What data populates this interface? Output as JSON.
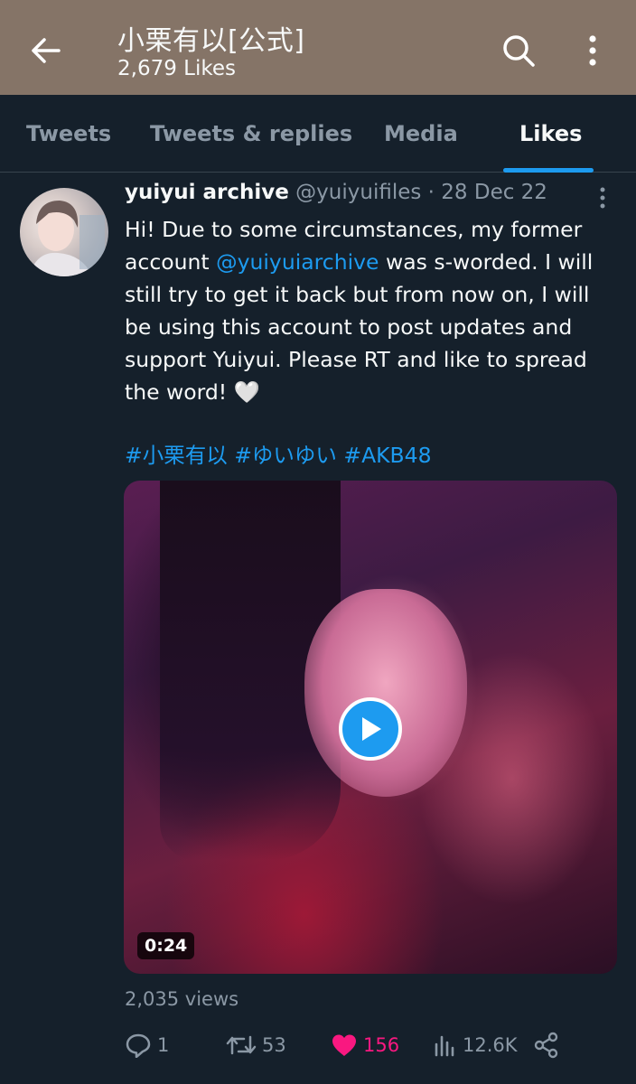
{
  "header": {
    "title": "小栗有以[公式]",
    "subtitle": "2,679 Likes",
    "background": "#857467"
  },
  "tabs": [
    {
      "label": "Tweets",
      "active": false
    },
    {
      "label": "Tweets & replies",
      "active": false
    },
    {
      "label": "Media",
      "active": false
    },
    {
      "label": "Likes",
      "active": true
    }
  ],
  "tweet": {
    "display_name": "yuiyui archive",
    "handle": "@yuiyuifiles",
    "date_separator": " · ",
    "date": "28 Dec 22",
    "text_part1": "Hi! Due to some circumstances, my former account ",
    "mention": "@yuiyuiarchive",
    "text_part2": " was s-worded. I will still try to get it back but from now on, I will be using this account to post updates and support Yuiyui. Please RT and like to spread the word! 🤍",
    "hashtags": [
      "#小栗有以",
      "#ゆいゆい",
      "#AKB48"
    ],
    "video_duration": "0:24",
    "views": "2,035 views",
    "actions": {
      "replies": "1",
      "retweets": "53",
      "likes": "156",
      "analytics": "12.6K"
    }
  },
  "colors": {
    "background": "#15202b",
    "accent": "#1d9bf0",
    "like": "#f91880",
    "muted": "#8b98a5"
  }
}
